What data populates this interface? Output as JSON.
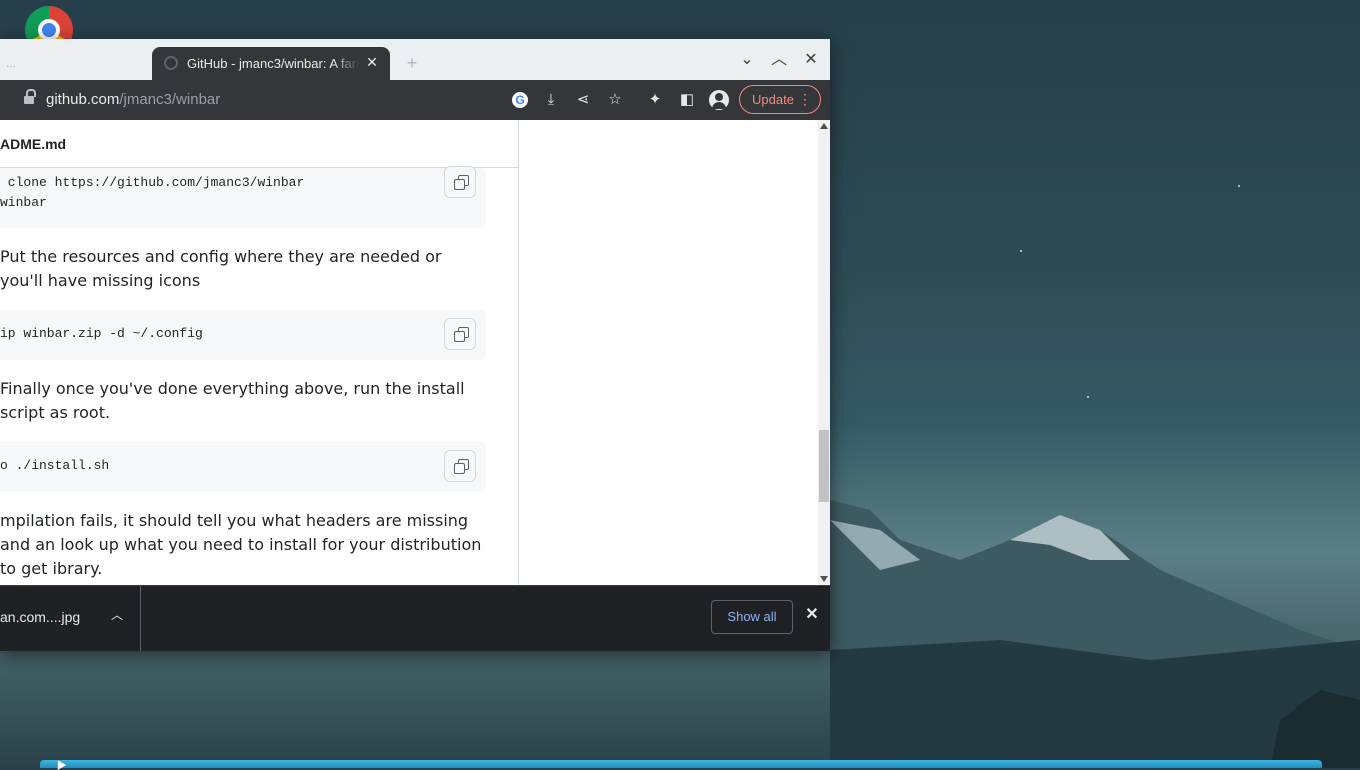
{
  "browser": {
    "tab_ghost_label": "...",
    "active_tab_title": "GitHub - jmanc3/winbar: A fan",
    "new_tab_symbol": "+",
    "url_domain": "github.com",
    "url_path": "/jmanc3/winbar",
    "update_label": "Update"
  },
  "readme": {
    "filename": "ADME.md",
    "code1_line1": " clone https://github.com/jmanc3/winbar",
    "code1_line2": "winbar",
    "para1": "Put the resources and config where they are needed or you'll have missing icons",
    "code2": "ip winbar.zip -d ~/.config",
    "para2": "Finally once you've done everything above, run the install script as root.",
    "code3": "o ./install.sh",
    "para3": "mpilation fails, it should tell you what headers are missing and an look up what you need to install for your distribution to get ibrary."
  },
  "downloads": {
    "file_name": "an.com....jpg",
    "show_all_label": "Show all"
  },
  "colors": {
    "accent_update": "#f28b82",
    "show_all": "#8ab4f8",
    "tab_active_bg": "#35363a"
  },
  "icons": [
    "chrome-icon",
    "github-favicon",
    "close-icon",
    "plus-icon",
    "chevron-down-icon",
    "minimize-icon",
    "close-window-icon",
    "lock-icon",
    "google-icon",
    "install-icon",
    "share-icon",
    "star-icon",
    "extensions-icon",
    "side-panel-icon",
    "profile-icon",
    "more-icon",
    "copy-icon",
    "chevron-up-icon"
  ]
}
